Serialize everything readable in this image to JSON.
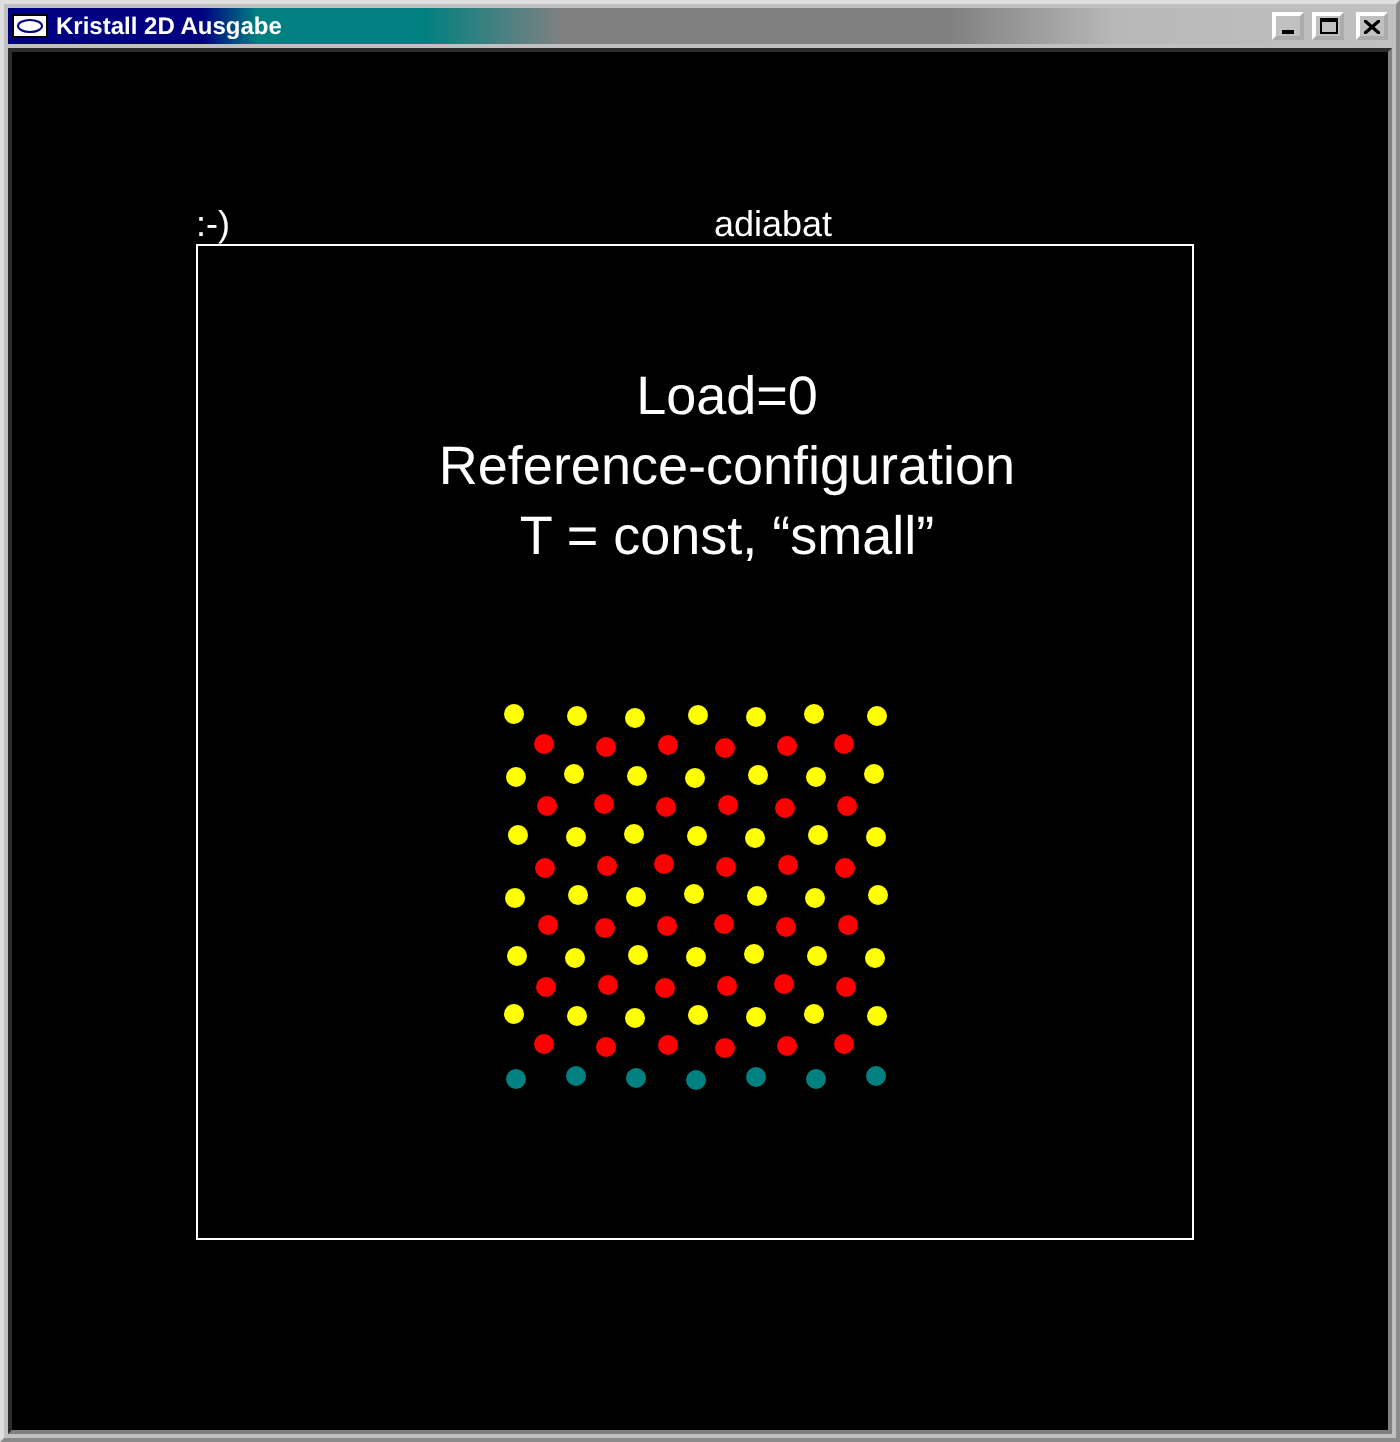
{
  "window": {
    "title": "Kristall 2D Ausgabe"
  },
  "plot": {
    "status": ":-)",
    "mode": "adiabat",
    "lines": [
      "Load=0",
      "Reference-configuration",
      "T = const, “small”"
    ]
  }
}
